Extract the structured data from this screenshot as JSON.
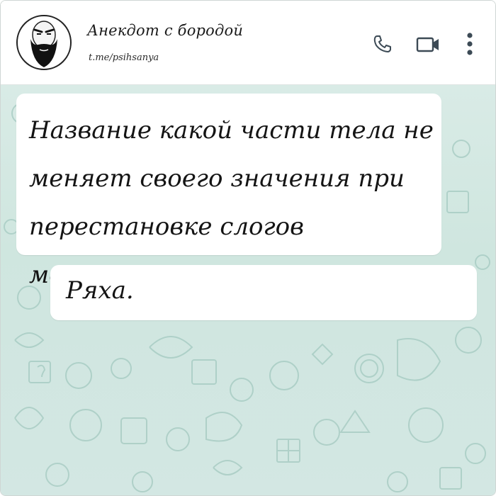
{
  "header": {
    "title": "Анекдот с бородой",
    "subtitle": "t.me/psihsanya",
    "icons": [
      "avatar",
      "phone-icon",
      "video-camera-icon",
      "more-vertical-icon"
    ]
  },
  "messages": [
    {
      "text": "Название какой части тела не меняет своего значения при перестановке слогов местами?"
    },
    {
      "text": "Ряха."
    }
  ],
  "colors": {
    "chat_background": "#d5e9e4",
    "bubble": "#ffffff",
    "header": "#ffffff",
    "icon": "#3c4a55"
  }
}
